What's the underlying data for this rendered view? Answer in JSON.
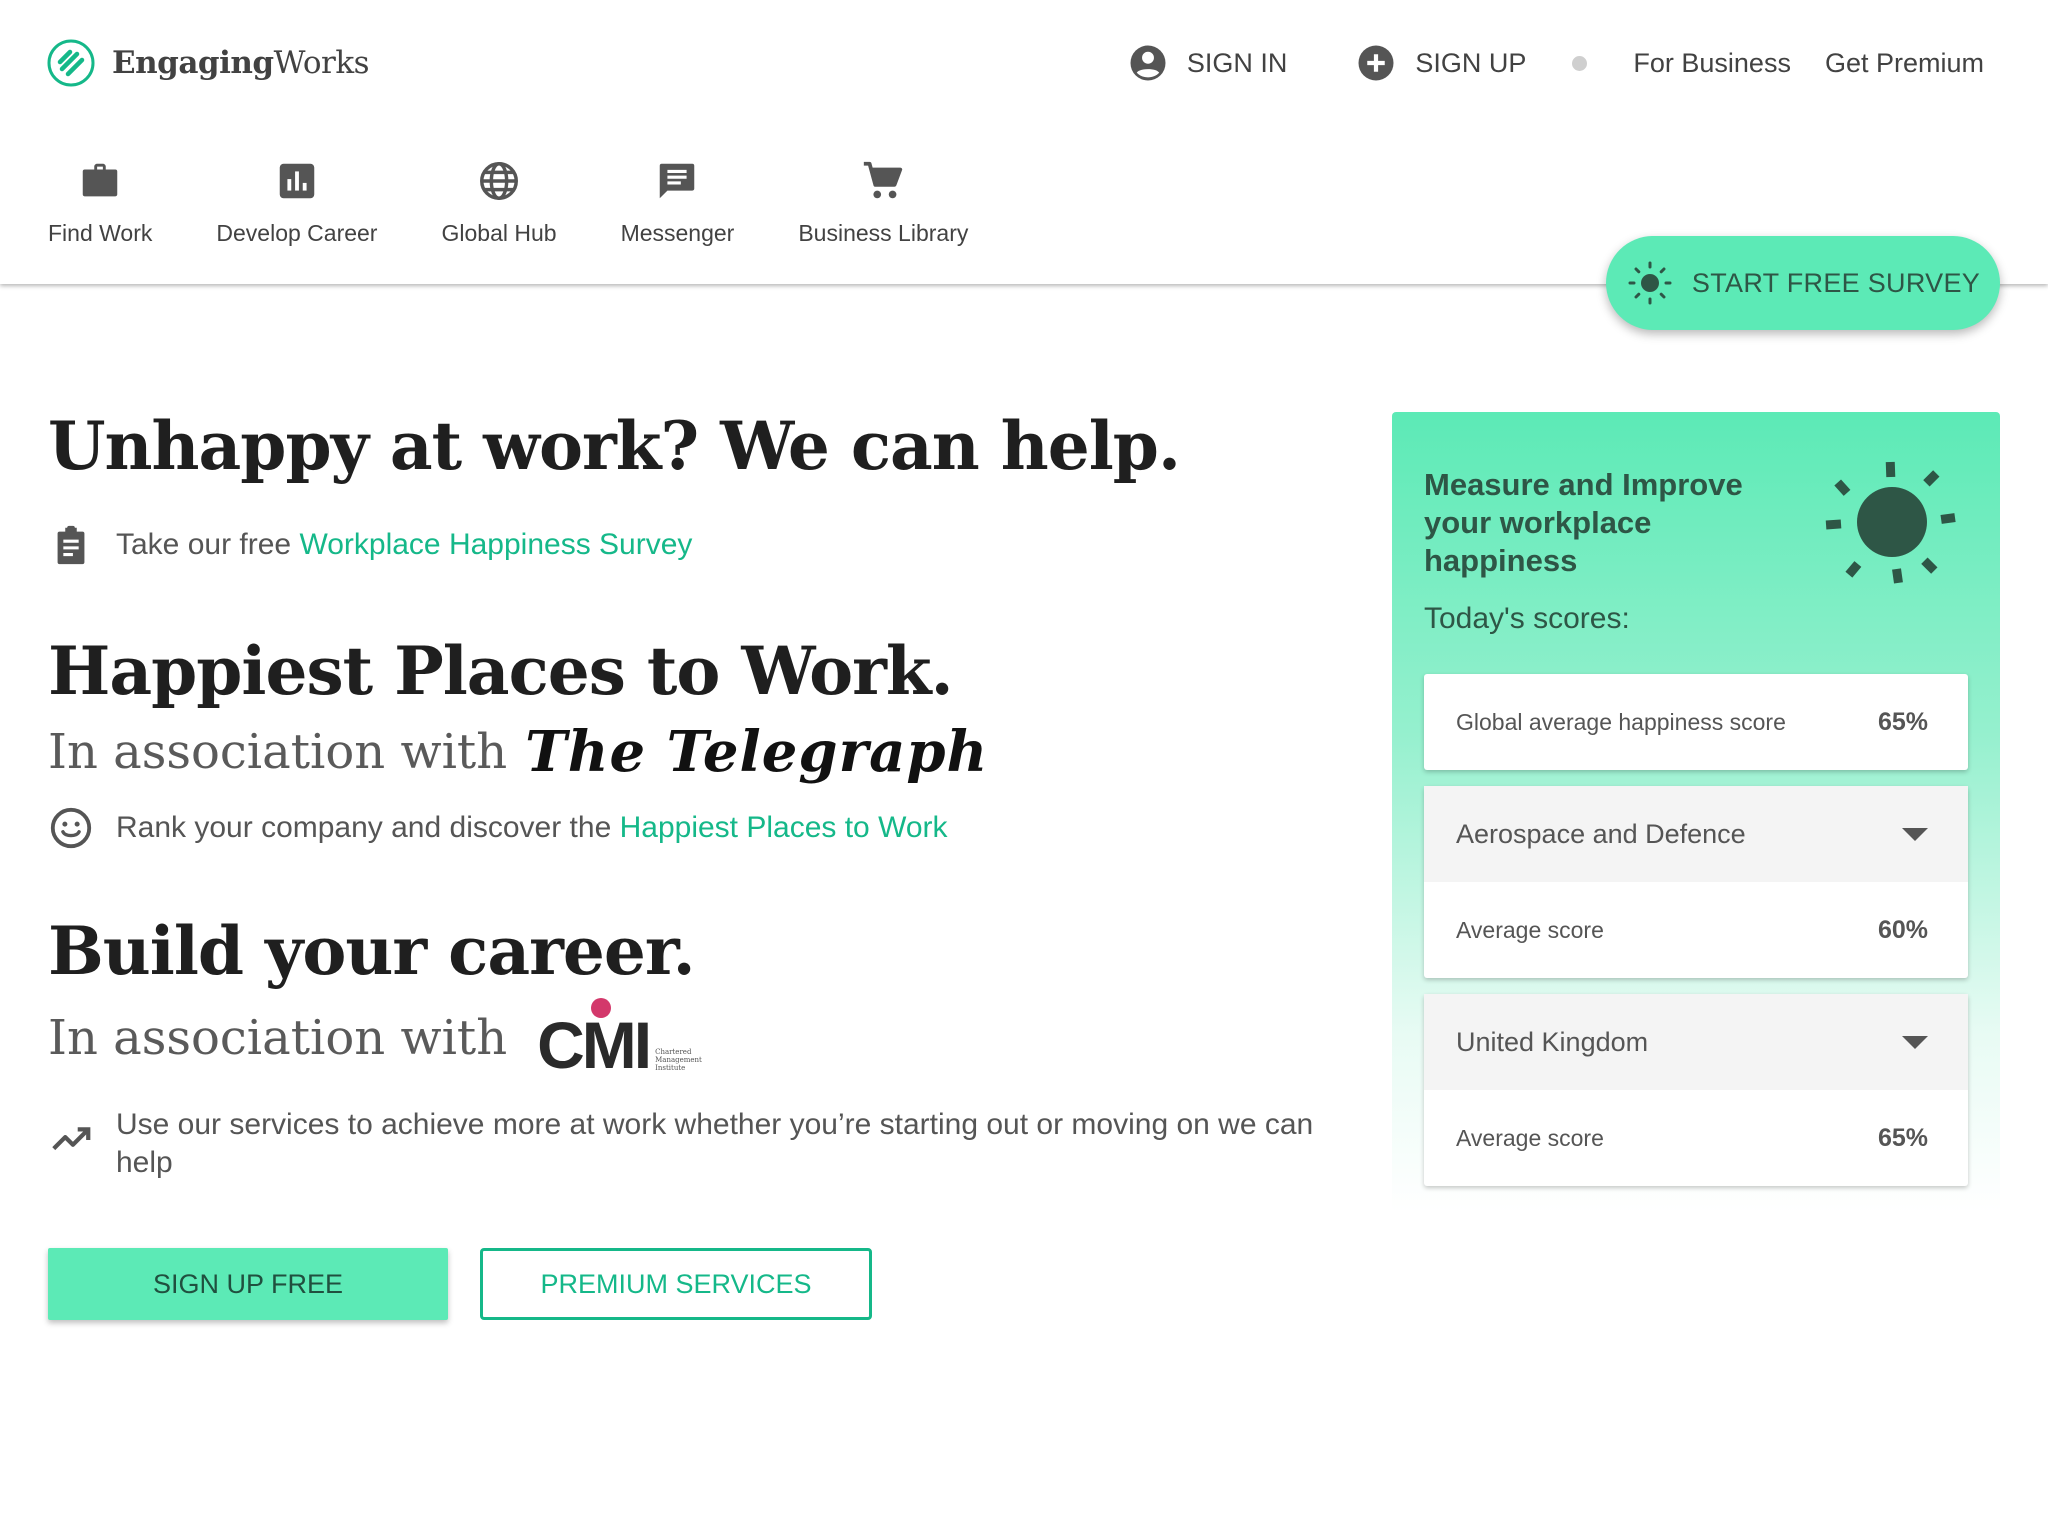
{
  "brand": {
    "name_bold": "Engaging",
    "name_regular": "Works",
    "accent_color": "#15b889",
    "primary_fill": "#5ceab6"
  },
  "topnav": {
    "sign_in": "SIGN IN",
    "sign_up": "SIGN UP",
    "for_business": "For Business",
    "get_premium": "Get Premium"
  },
  "mainnav": [
    {
      "label": "Find Work",
      "icon": "briefcase-icon"
    },
    {
      "label": "Develop Career",
      "icon": "bar-chart-icon"
    },
    {
      "label": "Global Hub",
      "icon": "globe-icon"
    },
    {
      "label": "Messenger",
      "icon": "message-icon"
    },
    {
      "label": "Business Library",
      "icon": "cart-icon"
    }
  ],
  "survey_button": {
    "label": "START FREE SURVEY",
    "icon": "sun-icon"
  },
  "hero": {
    "heading_1": "Unhappy at work? We can help.",
    "line_1_prefix": "Take our free ",
    "line_1_link": "Workplace Happiness Survey",
    "heading_2": "Happiest Places to Work.",
    "assoc_2": "In association with",
    "partner_2": "The Telegraph",
    "line_2_prefix": "Rank your company and discover the ",
    "line_2_link": "Happiest Places to Work",
    "heading_3": "Build your career.",
    "assoc_3": "In association with",
    "partner_3": "CMI",
    "partner_3_sub": "Chartered Management Institute",
    "line_3": "Use our services to achieve more at work whether you’re starting out or moving on we can help"
  },
  "buttons": {
    "sign_up_free": "SIGN UP FREE",
    "premium_services": "PREMIUM SERVICES"
  },
  "panel": {
    "title": "Measure and Improve your workplace happiness",
    "subtitle": "Today's scores:",
    "global": {
      "label": "Global average happiness score",
      "value": "65%"
    },
    "sector": {
      "selected": "Aerospace and Defence",
      "label": "Average score",
      "value": "60%"
    },
    "country": {
      "selected": "United Kingdom",
      "label": "Average score",
      "value": "65%"
    }
  }
}
